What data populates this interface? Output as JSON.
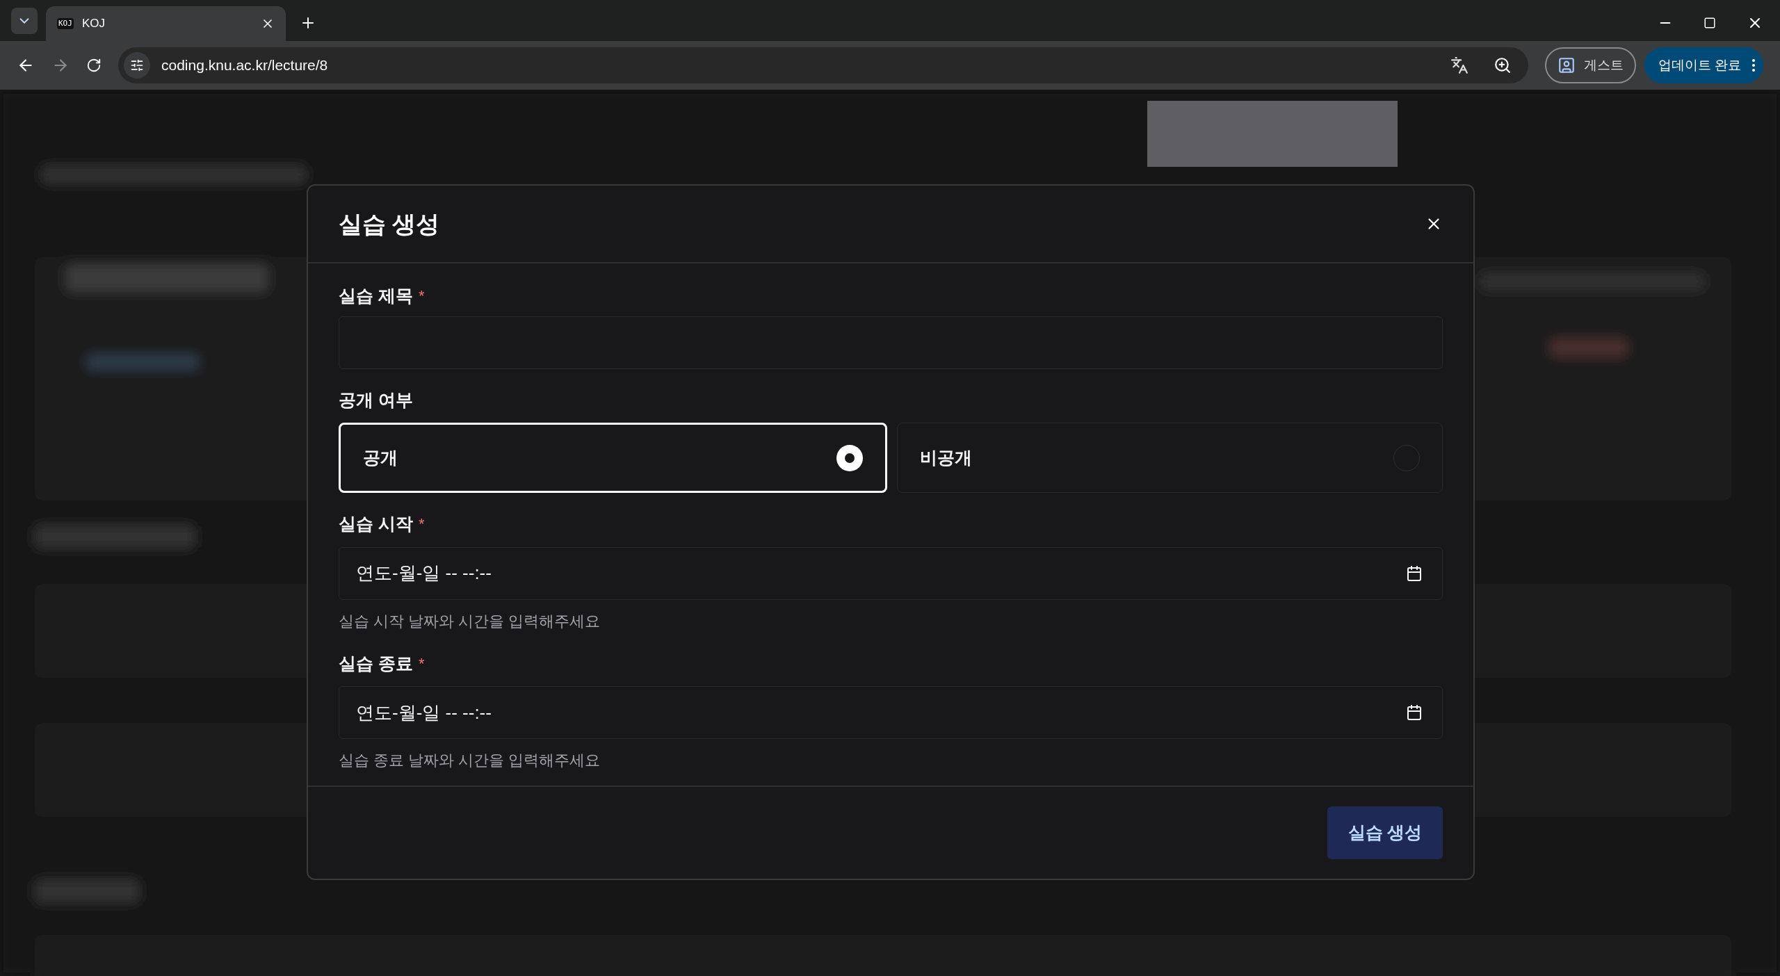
{
  "browser": {
    "tab": {
      "favicon": "KOJ",
      "title": "KOJ"
    },
    "url": "coding.knu.ac.kr/lecture/8",
    "profile": "게스트",
    "update_button": "업데이트 완료"
  },
  "dialog": {
    "title": "실습 생성",
    "fields": [
      {
        "kind": "text",
        "label": "실습 제목",
        "required_mark": "*"
      },
      {
        "kind": "radio",
        "label": "공개 여부",
        "options": [
          {
            "label": "공개",
            "selected": true
          },
          {
            "label": "비공개",
            "selected": false
          }
        ]
      },
      {
        "kind": "datetime",
        "label": "실습 시작",
        "required_mark": "*",
        "value": "연도-월-일 -- --:--",
        "hint": "실습 시작 날짜와 시간을 입력해주세요"
      },
      {
        "kind": "datetime",
        "label": "실습 종료",
        "required_mark": "*",
        "value": "연도-월-일 -- --:--",
        "hint": "실습 종료 날짜와 시간을 입력해주세요"
      }
    ],
    "submit": "실습 생성"
  }
}
